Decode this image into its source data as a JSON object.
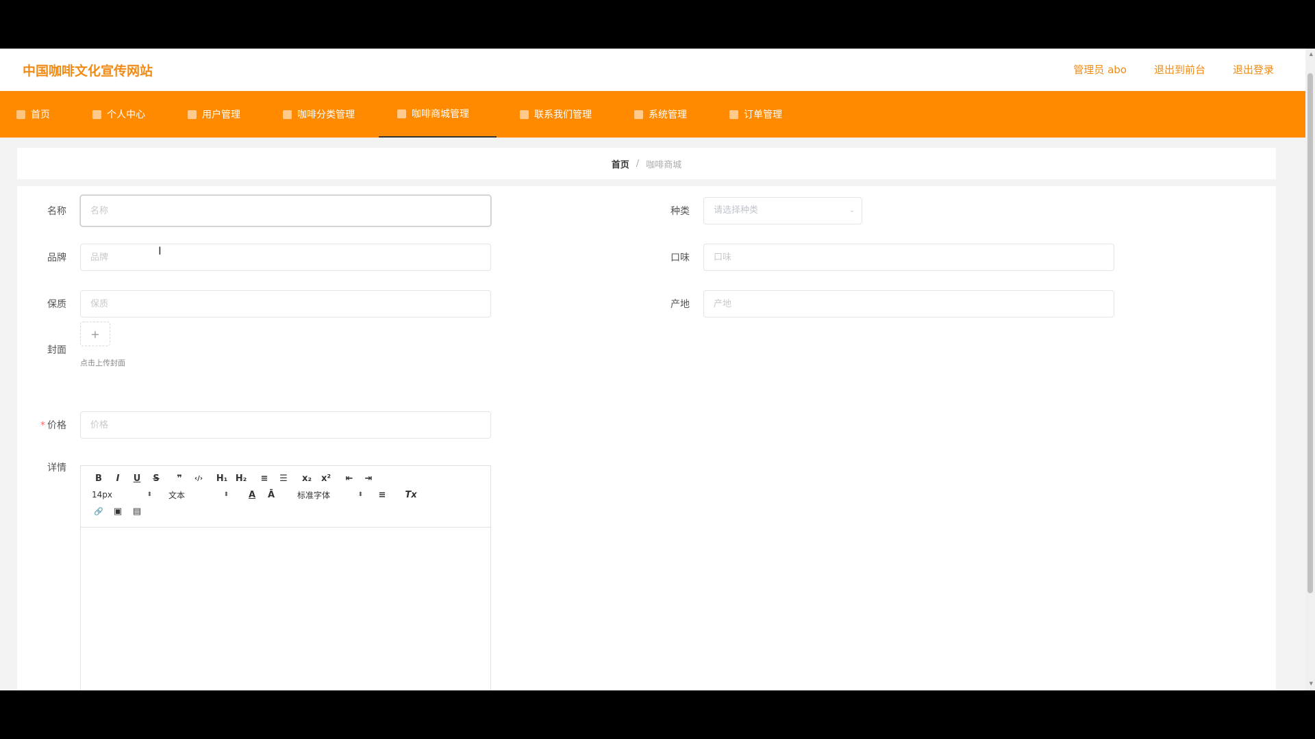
{
  "header": {
    "site_title": "中国咖啡文化宣传网站",
    "admin_label": "管理员 abo",
    "exit_backend": "退出到前台",
    "logout": "退出登录"
  },
  "nav": {
    "items": [
      {
        "label": "首页",
        "icon": "home-icon"
      },
      {
        "label": "个人中心",
        "icon": "user-icon"
      },
      {
        "label": "用户管理",
        "icon": "users-icon"
      },
      {
        "label": "咖啡分类管理",
        "icon": "category-icon"
      },
      {
        "label": "咖啡商城管理",
        "icon": "shop-icon",
        "active": true
      },
      {
        "label": "联系我们管理",
        "icon": "contact-icon"
      },
      {
        "label": "系统管理",
        "icon": "system-icon"
      },
      {
        "label": "订单管理",
        "icon": "order-icon"
      }
    ]
  },
  "breadcrumb": {
    "home": "首页",
    "separator": "/",
    "current": "咖啡商城"
  },
  "form": {
    "name_label": "名称",
    "name_placeholder": "名称",
    "category_label": "种类",
    "category_placeholder": "请选择种类",
    "brand_label": "品牌",
    "brand_placeholder": "品牌",
    "taste_label": "口味",
    "taste_placeholder": "口味",
    "shelf_label": "保质",
    "shelf_placeholder": "保质",
    "origin_label": "产地",
    "origin_placeholder": "产地",
    "cover_label": "封面",
    "cover_plus": "+",
    "cover_tip": "点击上传封面",
    "price_required": "*",
    "price_label": "价格",
    "price_placeholder": "价格",
    "detail_label": "详情"
  },
  "editor": {
    "font_size": "14px",
    "header_select": "文本",
    "font_family": "标准字体",
    "buttons": {
      "bold": "B",
      "italic": "I",
      "underline": "U",
      "strike": "S",
      "quote": "❞",
      "code": "‹/›",
      "h1": "H₁",
      "h2": "H₂",
      "ol": "≡",
      "ul": "☰",
      "sub": "x₂",
      "sup": "x²",
      "outdent": "⇤",
      "indent": "⇥",
      "color": "A",
      "background": "Ā",
      "align": "≡",
      "clean": "Tx",
      "link": "🔗",
      "image": "▣",
      "video": "▤"
    }
  },
  "colors": {
    "accent": "#ff8a00",
    "title": "#f08b16"
  }
}
